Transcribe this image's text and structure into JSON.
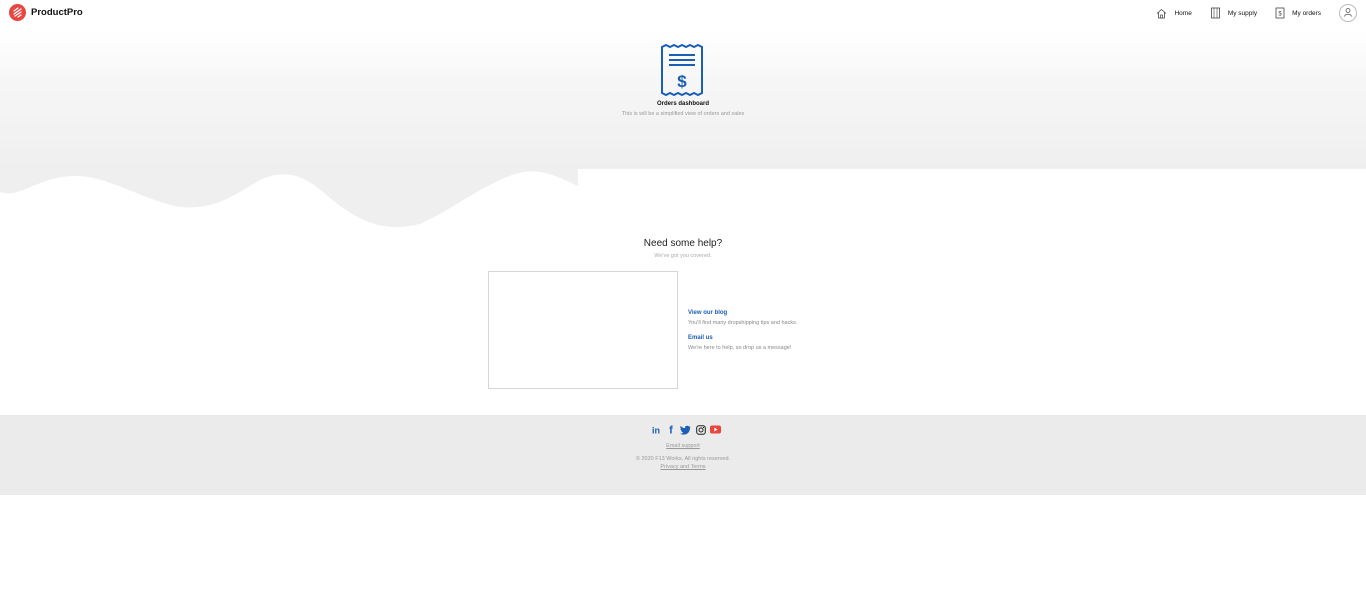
{
  "header": {
    "brand_name": "ProductPro",
    "nav": [
      {
        "label": "Home",
        "icon": "home-icon"
      },
      {
        "label": "My supply",
        "icon": "building-icon"
      },
      {
        "label": "My orders",
        "icon": "receipt-icon"
      }
    ],
    "account_icon": "user-icon"
  },
  "hero": {
    "icon": "receipt-dollar-icon",
    "title": "Orders dashboard",
    "subtitle": "This is will be a simplified view of orders and sales"
  },
  "help": {
    "title": "Need some help?",
    "subtitle": "We've got you covered.",
    "blog_link": "View our blog",
    "blog_desc": "You'll find many dropshipping tips and hacks.",
    "email_link": "Email us",
    "email_desc": "We're here to help, so drop us a message!"
  },
  "footer": {
    "socials": [
      "linkedin-icon",
      "facebook-icon",
      "twitter-icon",
      "instagram-icon",
      "youtube-icon"
    ],
    "email_support": "Email support",
    "copyright": "© 2020 F13 Works. All rights reserved.",
    "privacy": "Privacy and Terms"
  },
  "colors": {
    "brand": "#e8463f",
    "accent": "#1a5fb4",
    "hero_bg": "#efefef",
    "footer_bg": "#ebebeb"
  }
}
